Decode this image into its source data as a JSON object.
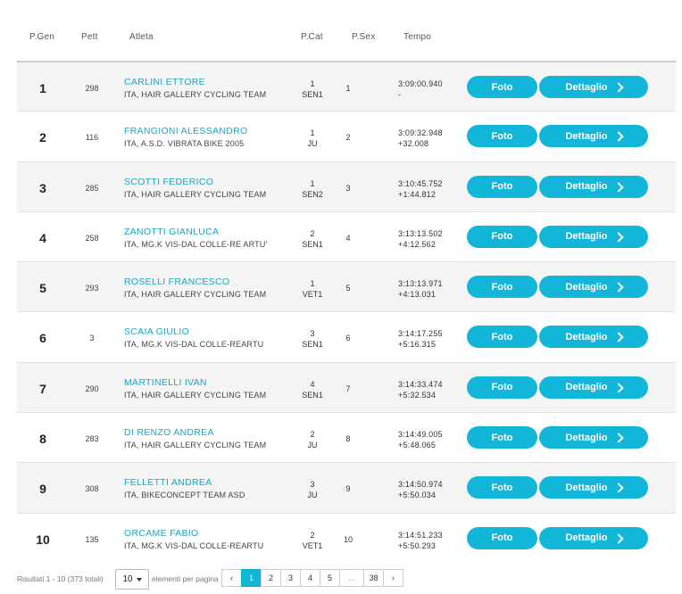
{
  "headers": {
    "pgen": "P.Gen",
    "pett": "Pett",
    "atleta": "Atleta",
    "pcat": "P.Cat",
    "psex": "P.Sex",
    "tempo": "Tempo"
  },
  "buttons": {
    "foto": "Foto",
    "dettaglio": "Dettaglio"
  },
  "rows": [
    {
      "pos": "1",
      "bib": "298",
      "name": "CARLINI ETTORE",
      "team": "ITA, HAIR GALLERY CYCLING TEAM",
      "cat_pos": "1",
      "cat": "SEN1",
      "psex": "1",
      "time": "3:09:00.940",
      "gap": "-"
    },
    {
      "pos": "2",
      "bib": "116",
      "name": "FRANGIONI ALESSANDRO",
      "team": "ITA, A.S.D. VIBRATA BIKE 2005",
      "cat_pos": "1",
      "cat": "JU",
      "psex": "2",
      "time": "3:09:32.948",
      "gap": "+32.008"
    },
    {
      "pos": "3",
      "bib": "285",
      "name": "SCOTTI FEDERICO",
      "team": "ITA, HAIR GALLERY CYCLING TEAM",
      "cat_pos": "1",
      "cat": "SEN2",
      "psex": "3",
      "time": "3:10:45.752",
      "gap": "+1:44.812"
    },
    {
      "pos": "4",
      "bib": "258",
      "name": "ZANOTTI GIANLUCA",
      "team": "ITA, MG.K VIS-DAL COLLE-RE ARTU'",
      "cat_pos": "2",
      "cat": "SEN1",
      "psex": "4",
      "time": "3:13:13.502",
      "gap": "+4:12.562"
    },
    {
      "pos": "5",
      "bib": "293",
      "name": "ROSELLI FRANCESCO",
      "team": "ITA, HAIR GALLERY CYCLING TEAM",
      "cat_pos": "1",
      "cat": "VET1",
      "psex": "5",
      "time": "3:13:13.971",
      "gap": "+4:13.031"
    },
    {
      "pos": "6",
      "bib": "3",
      "name": "SCAIA GIULIO",
      "team": "ITA, MG.K VIS-DAL COLLE-REARTU",
      "cat_pos": "3",
      "cat": "SEN1",
      "psex": "6",
      "time": "3:14:17.255",
      "gap": "+5:16.315"
    },
    {
      "pos": "7",
      "bib": "290",
      "name": "MARTINELLI IVAN",
      "team": "ITA, HAIR GALLERY CYCLING TEAM",
      "cat_pos": "4",
      "cat": "SEN1",
      "psex": "7",
      "time": "3:14:33.474",
      "gap": "+5:32.534"
    },
    {
      "pos": "8",
      "bib": "283",
      "name": "DI RENZO ANDREA",
      "team": "ITA, HAIR GALLERY CYCLING TEAM",
      "cat_pos": "2",
      "cat": "JU",
      "psex": "8",
      "time": "3:14:49.005",
      "gap": "+5:48.065"
    },
    {
      "pos": "9",
      "bib": "308",
      "name": "FELLETTI ANDREA",
      "team": "ITA, BIKECONCEPT TEAM ASD",
      "cat_pos": "3",
      "cat": "JU",
      "psex": "9",
      "time": "3:14:50.974",
      "gap": "+5:50.034"
    },
    {
      "pos": "10",
      "bib": "135",
      "name": "ORCAME FABIO",
      "team": "ITA, MG.K VIS-DAL COLLE-REARTU",
      "cat_pos": "2",
      "cat": "VET1",
      "psex": "10",
      "time": "3:14:51.233",
      "gap": "+5:50.293"
    }
  ],
  "footer": {
    "results_text": "Risultati 1 - 10 (373 totali)",
    "per_page_value": "10",
    "per_page_label": "elementi per pagina",
    "pages": [
      "‹",
      "1",
      "2",
      "3",
      "4",
      "5",
      "...",
      "38",
      "›"
    ],
    "active_page": "1"
  },
  "colors": {
    "accent": "#12b6d8",
    "name_link": "#1aa7c4",
    "row_alt": "#f4f4f4"
  }
}
